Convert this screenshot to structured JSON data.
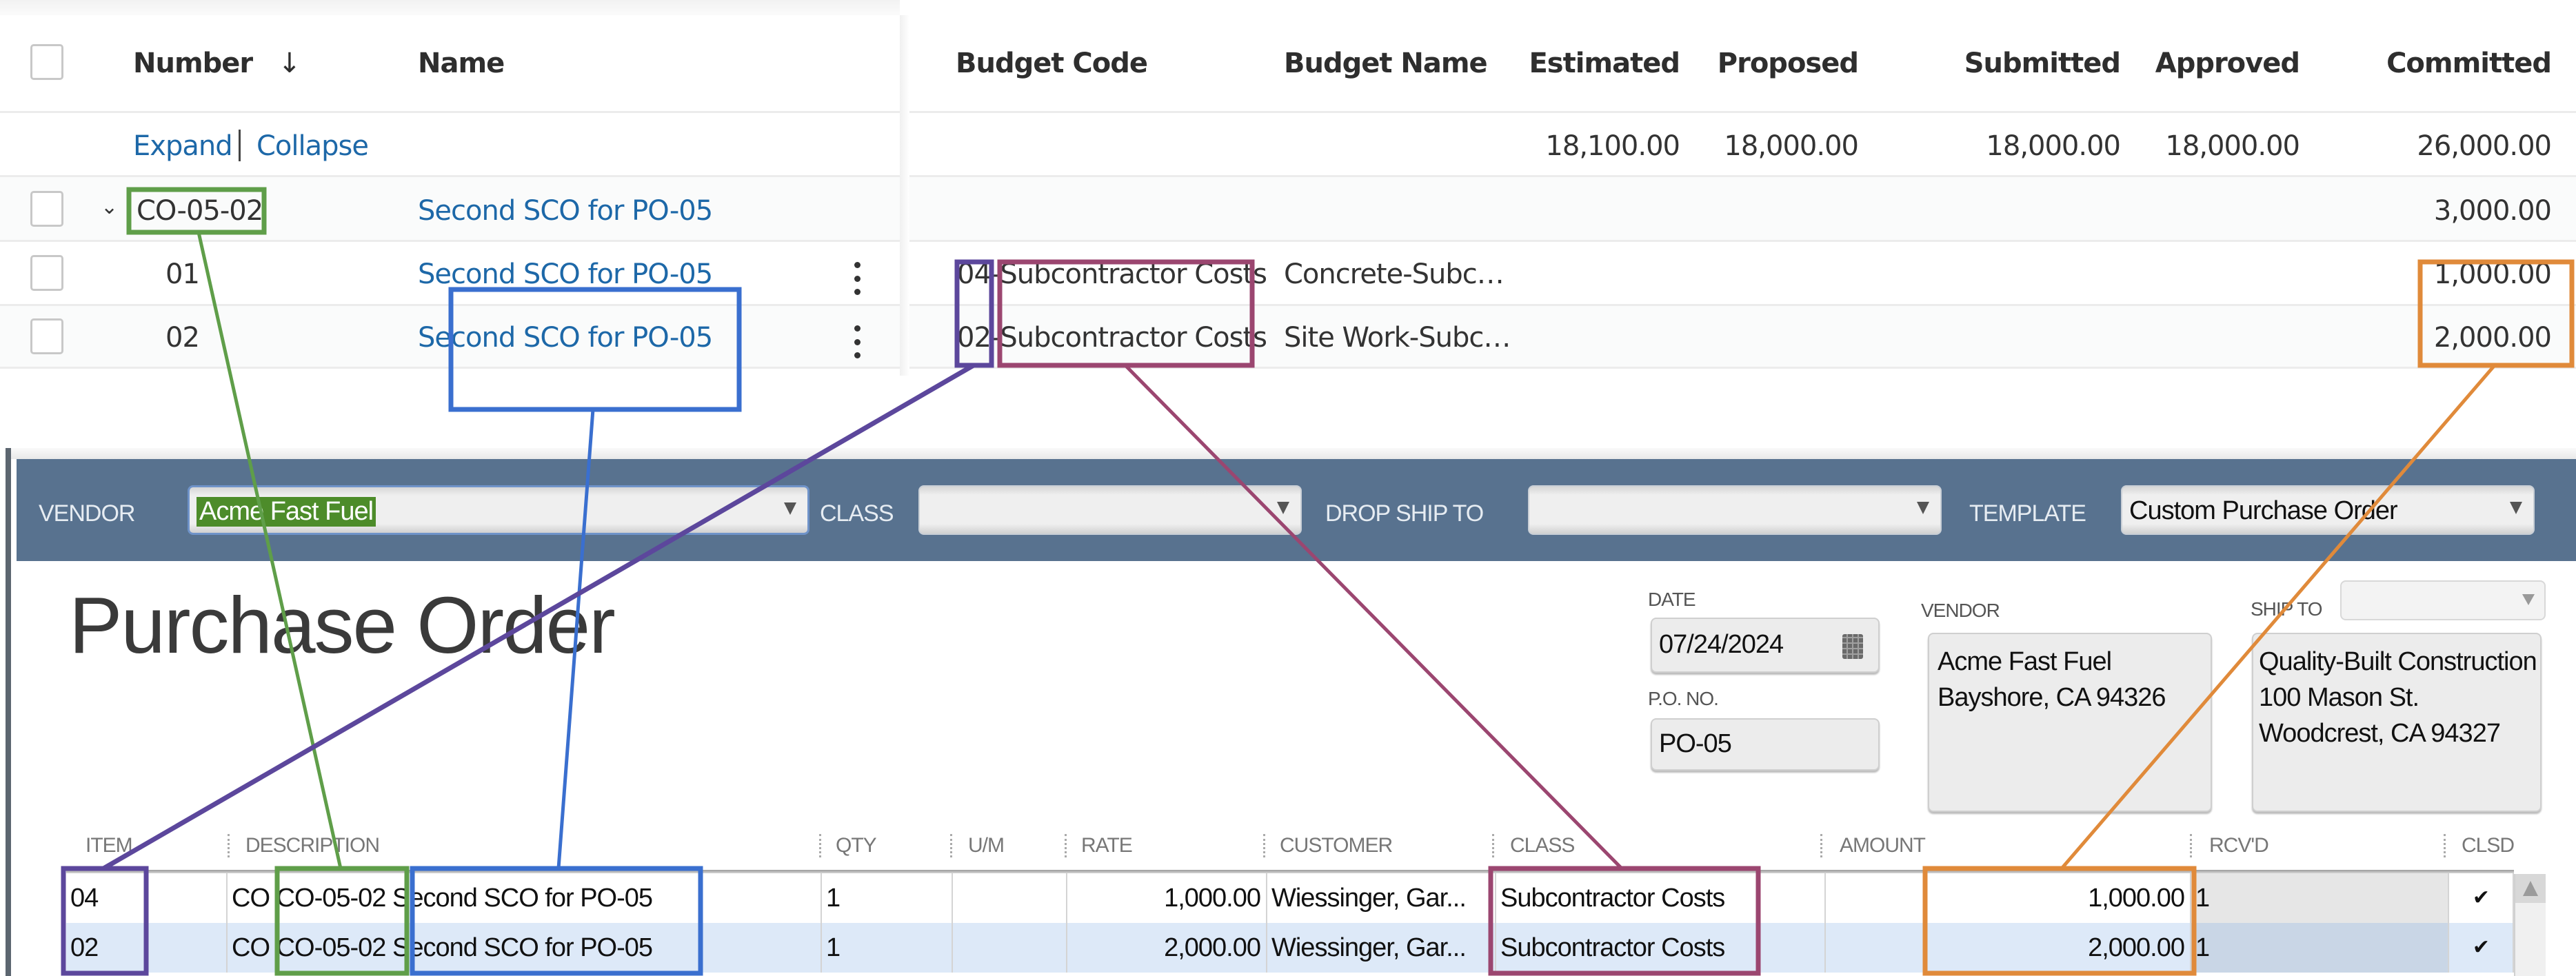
{
  "top_table": {
    "headers": {
      "number": "Number",
      "sort_icon": "arrow-down-icon",
      "name": "Name",
      "budget_code": "Budget Code",
      "budget_name": "Budget Name",
      "estimated": "Estimated",
      "proposed": "Proposed",
      "submitted": "Submitted",
      "approved": "Approved",
      "committed": "Committed"
    },
    "toggle": {
      "expand": "Expand",
      "collapse": "Collapse"
    },
    "totals": {
      "estimated": "18,100.00",
      "proposed": "18,000.00",
      "submitted": "18,000.00",
      "approved": "18,000.00",
      "committed": "26,000.00"
    },
    "group": {
      "number": "CO-05-02",
      "name": "Second SCO for PO-05",
      "committed": "3,000.00"
    },
    "rows": [
      {
        "number": "01",
        "name": "Second SCO for PO-05",
        "budget_code": "04-Subcontractor Costs",
        "budget_code_prefix": "04",
        "budget_code_label": "Subcontractor Costs",
        "budget_name": "Concrete-Subc…",
        "committed": "1,000.00"
      },
      {
        "number": "02",
        "name": "Second SCO for PO-05",
        "budget_code": "02-Subcontractor Costs",
        "budget_code_prefix": "02",
        "budget_code_label": "Subcontractor Costs",
        "budget_name": "Site Work-Subc…",
        "committed": "2,000.00"
      }
    ]
  },
  "purchase_order": {
    "toolbar": {
      "vendor_label": "VENDOR",
      "vendor_value": "Acme Fast Fuel",
      "class_label": "CLASS",
      "class_value": "",
      "drop_ship_label": "DROP SHIP TO",
      "drop_ship_value": "",
      "template_label": "TEMPLATE",
      "template_value": "Custom Purchase Order"
    },
    "title": "Purchase Order",
    "date_label": "DATE",
    "date_value": "07/24/2024",
    "po_no_label": "P.O. NO.",
    "po_no_value": "PO-05",
    "vendor_label": "VENDOR",
    "vendor_address": [
      "Acme Fast Fuel",
      "Bayshore, CA 94326"
    ],
    "ship_to_label": "SHIP TO",
    "ship_to_value": "",
    "ship_to_address": [
      "Quality-Built Construction",
      "100 Mason St.",
      "Woodcrest, CA 94327"
    ],
    "grid": {
      "headers": [
        "ITEM",
        "DESCRIPTION",
        "QTY",
        "U/M",
        "RATE",
        "CUSTOMER",
        "CLASS",
        "AMOUNT",
        "RCV'D",
        "CLSD"
      ],
      "rows": [
        {
          "item": "04",
          "description_prefix": "CO",
          "description_code": "CO-05-02",
          "description_text": "Second SCO for PO-05",
          "qty": "1",
          "um": "",
          "rate": "1,000.00",
          "customer": "Wiessinger, Gar...",
          "class": "Subcontractor Costs",
          "amount": "1,000.00",
          "rcvd": "1",
          "clsd": "✔"
        },
        {
          "item": "02",
          "description_prefix": "CO",
          "description_code": "CO-05-02",
          "description_text": "Second SCO for PO-05",
          "qty": "1",
          "um": "",
          "rate": "2,000.00",
          "customer": "Wiessinger, Gar...",
          "class": "Subcontractor Costs",
          "amount": "2,000.00",
          "rcvd": "1",
          "clsd": "✔"
        }
      ]
    }
  },
  "annotation_colors": {
    "number_link": "#5f9e49",
    "name_link": "#3a6fcf",
    "budget_code_link": "#5c479c",
    "budget_label_link": "#9b4670",
    "amount_link": "#e08a3a"
  },
  "colors": {
    "link_blue": "#1d68a8",
    "toolbar_bg": "#58728f",
    "vendor_selection": "#4d8c2a",
    "selected_row": "#dde9f8"
  }
}
